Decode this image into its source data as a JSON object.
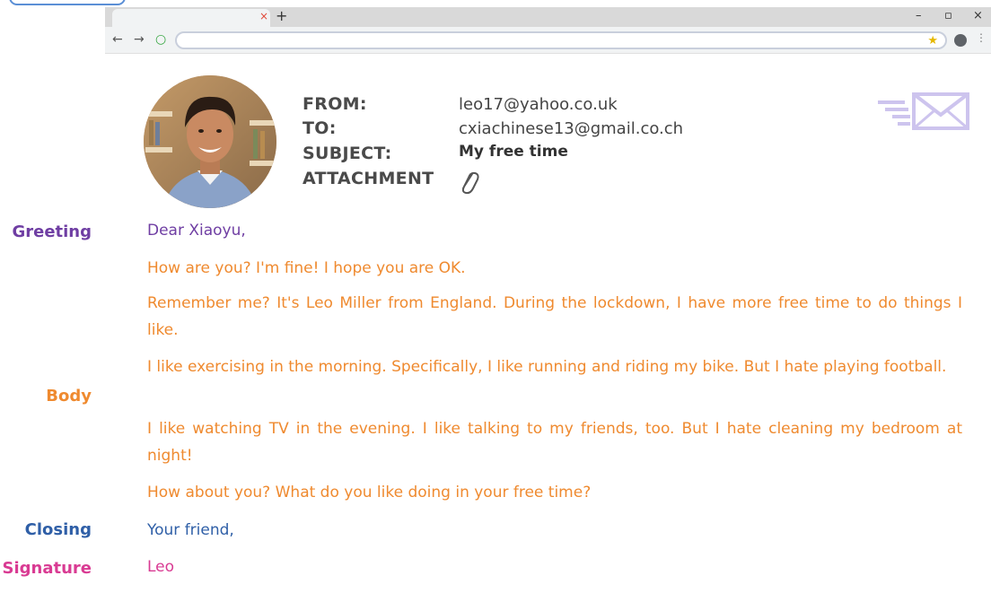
{
  "labels": {
    "greeting": "Greeting",
    "body": "Body",
    "closing": "Closing",
    "signature": "Signature"
  },
  "colors": {
    "greeting": "#6f3ea3",
    "body": "#ef8a2f",
    "closing": "#2f5fa7",
    "signature": "#d93b93"
  },
  "browser": {
    "tab_close": "×",
    "new_tab": "+",
    "minimize": "–",
    "restore": "▫",
    "close": "×",
    "back": "←",
    "forward": "→",
    "reload": "○",
    "bookmark": "★",
    "menu": "⋮"
  },
  "email": {
    "from_label": "FROM:",
    "to_label": "TO:",
    "subject_label": "SUBJECT:",
    "attachment_label": "ATTACHMENT",
    "from": "leo17@yahoo.co.uk",
    "to": "cxiachinese13@gmail.co.ch",
    "subject": "My free time",
    "greeting": "Dear Xiaoyu,",
    "body": [
      "How are you? I'm fine! I hope you are OK.",
      "Remember me? It's Leo Miller from England. During the lockdown, I have more free time to do things I like.",
      "I like exercising in the morning. Specifically, I like running and riding my bike. But I hate playing football.",
      "I like watching TV in the evening. I like talking to my friends, too. But I hate cleaning my bedroom at night!",
      "How about you? What do you like doing in your free time?"
    ],
    "closing": "Your friend,",
    "signature": "Leo"
  }
}
